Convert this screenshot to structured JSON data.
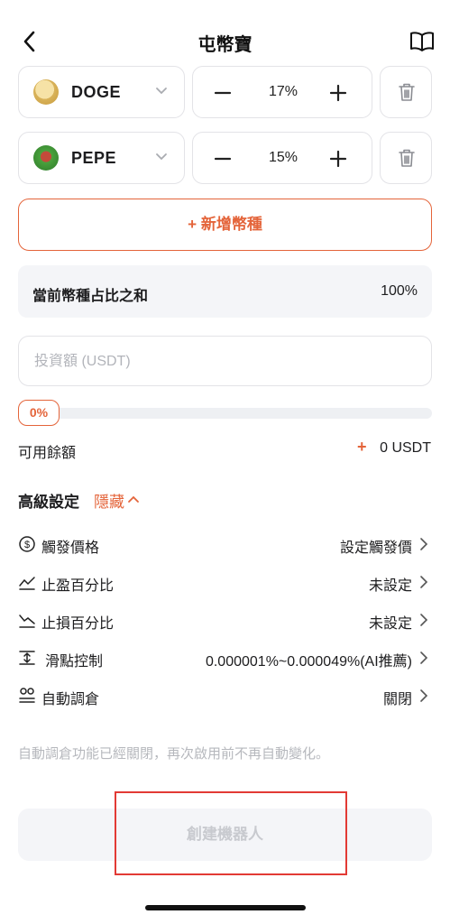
{
  "header": {
    "title": "屯幣寶",
    "back_icon": "chevron-left-icon",
    "guide_icon": "book-icon"
  },
  "coins": [
    {
      "name": "DOGE",
      "percent": "17%",
      "logo_color": "#d9b35a"
    },
    {
      "name": "PEPE",
      "percent": "15%",
      "logo_color": "#3f8f3a"
    }
  ],
  "add_coin": {
    "label": "+ 新增幣種"
  },
  "sum_row": {
    "label": "當前幣種占比之和",
    "value": "100%"
  },
  "investment": {
    "placeholder": "投資額 (USDT)",
    "value": ""
  },
  "slider": {
    "percent_label": "0%",
    "percent": 0
  },
  "available": {
    "label": "可用餘額",
    "plus": "+",
    "value": "0 USDT"
  },
  "advanced": {
    "title": "高級設定",
    "toggle_label": "隱藏",
    "rows": [
      {
        "icon": "dollar-circle-icon",
        "label": "觸發價格",
        "value": "設定觸發價"
      },
      {
        "icon": "take-profit-icon",
        "label": "止盈百分比",
        "value": "未設定"
      },
      {
        "icon": "stop-loss-icon",
        "label": "止損百分比",
        "value": "未設定"
      },
      {
        "icon": "slippage-icon",
        "label": "滑點控制",
        "value": "0.000001%~0.000049%(AI推薦)"
      },
      {
        "icon": "rebalance-icon",
        "label": "自動調倉",
        "value": "關閉"
      }
    ]
  },
  "note": "自動調倉功能已經關閉，再次啟用前不再自動變化。",
  "create_button": {
    "label": "創建機器人"
  },
  "colors": {
    "accent": "#e4643a",
    "highlight": "#e23a35"
  }
}
